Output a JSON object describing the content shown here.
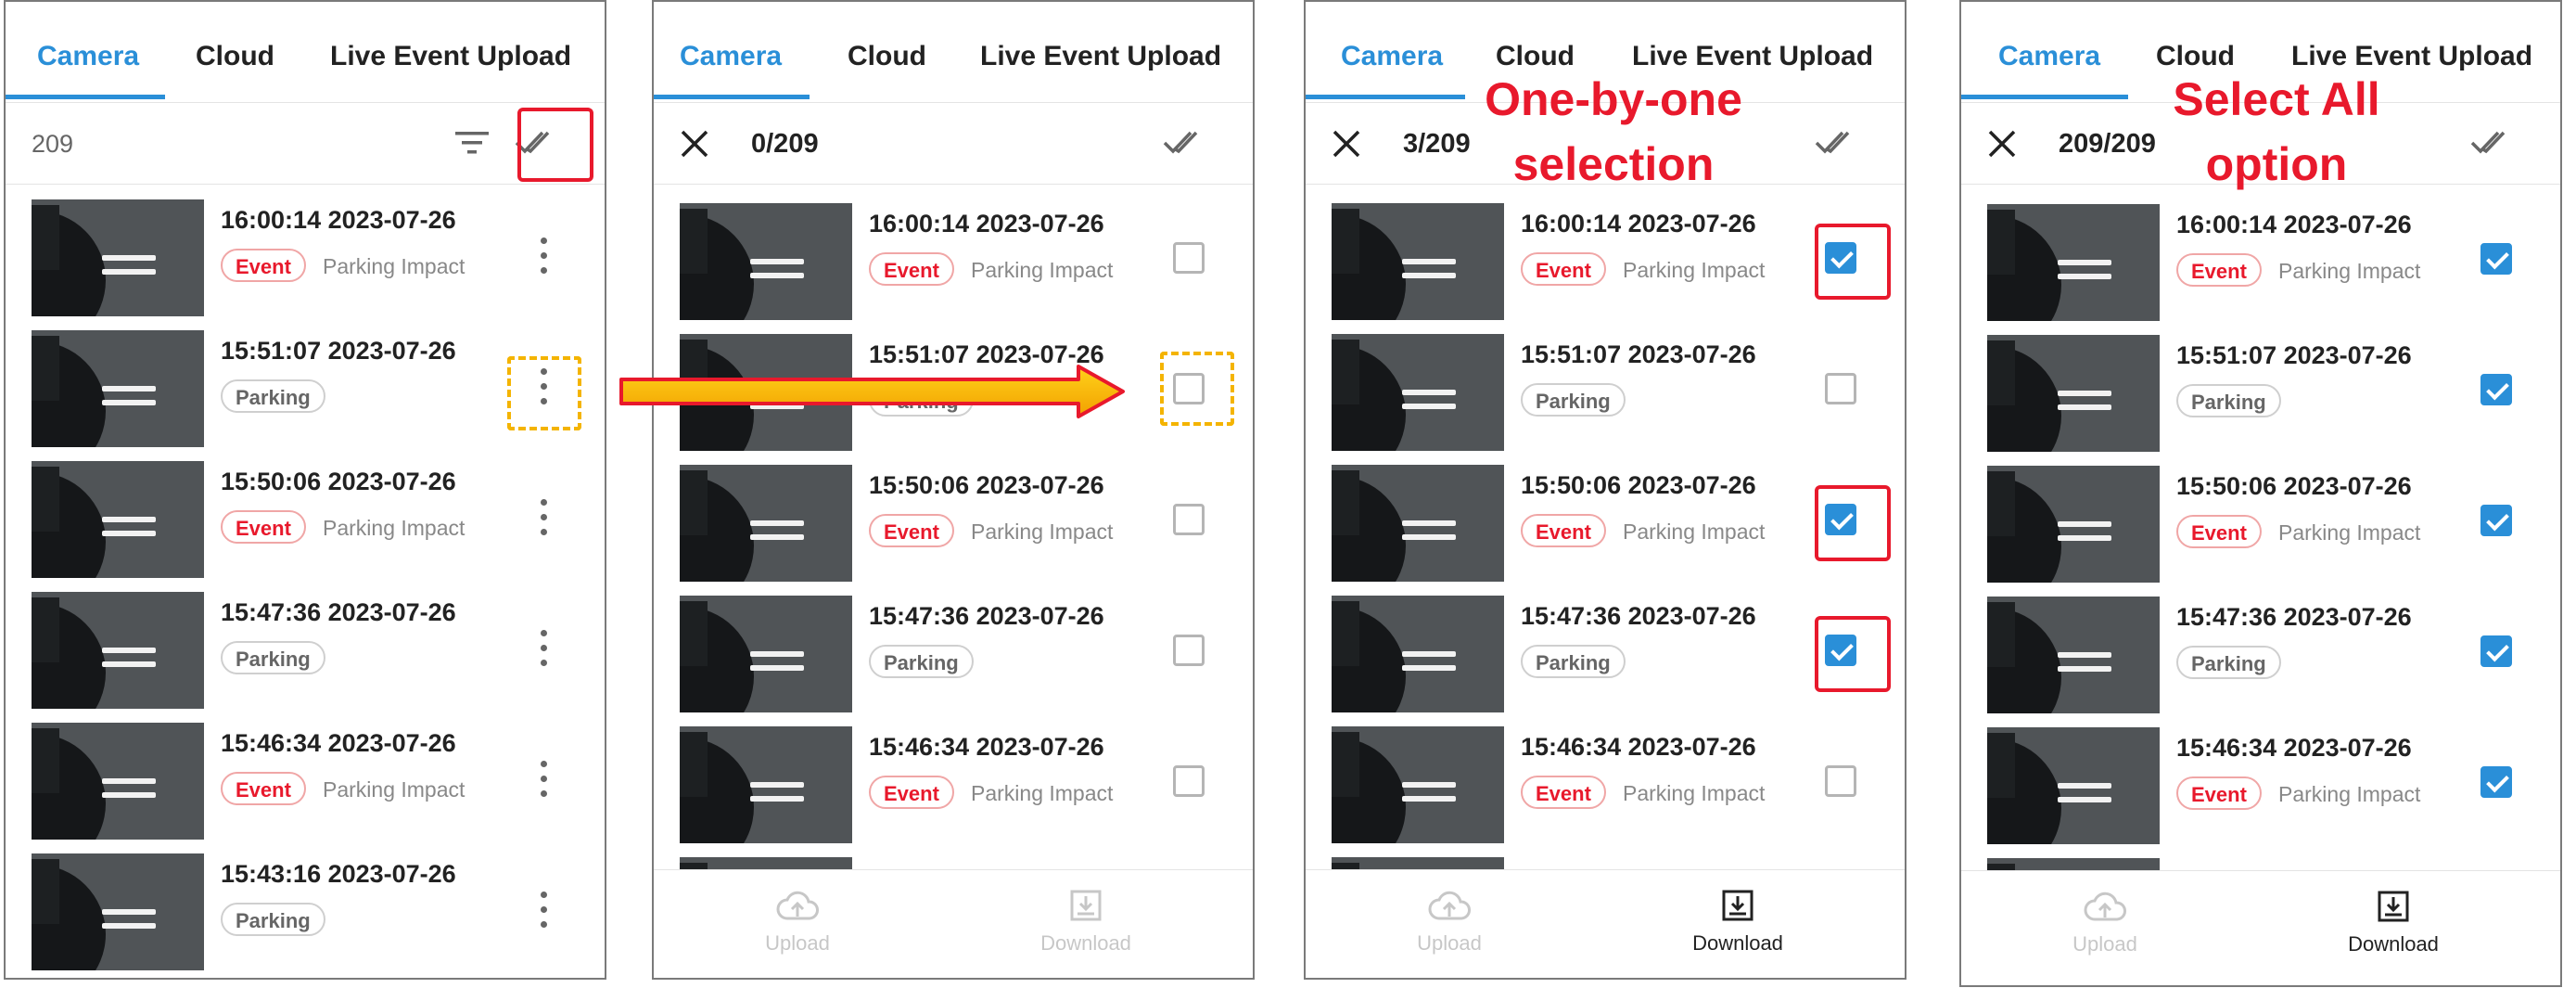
{
  "tabs": [
    "Camera",
    "Cloud",
    "Live Event Upload"
  ],
  "colors": {
    "accent": "#2a8fd8",
    "event_red": "#e8192c",
    "highlight_red": "#e8192c",
    "highlight_yellow": "#f4b400"
  },
  "rows": [
    {
      "time": "16:00:14 2023-07-26",
      "badge": "Event",
      "type": "Parking Impact"
    },
    {
      "time": "15:51:07 2023-07-26",
      "badge": "Parking",
      "type": ""
    },
    {
      "time": "15:50:06 2023-07-26",
      "badge": "Event",
      "type": "Parking Impact"
    },
    {
      "time": "15:47:36 2023-07-26",
      "badge": "Parking",
      "type": ""
    },
    {
      "time": "15:46:34 2023-07-26",
      "badge": "Event",
      "type": "Parking Impact"
    },
    {
      "time": "15:43:16 2023-07-26",
      "badge": "Parking",
      "type": ""
    }
  ],
  "panel1": {
    "count": "209"
  },
  "panel2": {
    "count": "0/209",
    "checked": [
      false,
      false,
      false,
      false,
      false
    ]
  },
  "panel3": {
    "count": "3/209",
    "checked": [
      true,
      false,
      true,
      true,
      false
    ],
    "annotation_line1": "One-by-one",
    "annotation_line2": "selection"
  },
  "panel4": {
    "count": "209/209",
    "checked": [
      true,
      true,
      true,
      true,
      true
    ],
    "annotation_line1": "Select All",
    "annotation_line2": "option"
  },
  "footer": {
    "upload_label": "Upload",
    "download_label": "Download"
  },
  "icons": {
    "close": "close-icon",
    "filter": "filter-icon",
    "select_all": "double-check-icon",
    "more": "more-vertical-icon",
    "upload": "cloud-upload-icon",
    "download": "download-icon"
  }
}
